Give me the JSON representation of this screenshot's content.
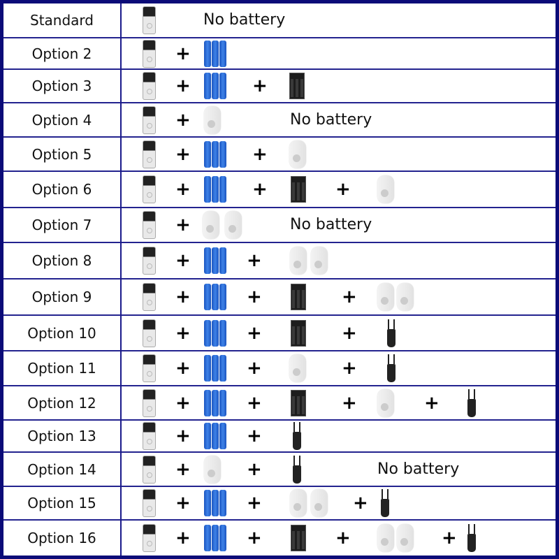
{
  "colors": {
    "border": "#0b0b78",
    "battery": "#2d6fd8"
  },
  "rows": [
    {
      "label": "Standard",
      "items": [
        {
          "type": "doorbell-icon"
        },
        {
          "type": "text",
          "text": "No battery"
        }
      ]
    },
    {
      "label": "Option 2",
      "items": [
        {
          "type": "doorbell-icon"
        },
        {
          "type": "plus",
          "text": "+"
        },
        {
          "type": "batteries-icon"
        }
      ]
    },
    {
      "label": "Option 3",
      "items": [
        {
          "type": "doorbell-icon"
        },
        {
          "type": "plus",
          "text": "+"
        },
        {
          "type": "batteries-icon"
        },
        {
          "type": "plus",
          "text": "+"
        },
        {
          "type": "charger-icon"
        }
      ]
    },
    {
      "label": "Option 4",
      "items": [
        {
          "type": "doorbell-icon"
        },
        {
          "type": "plus",
          "text": "+"
        },
        {
          "type": "chime-icon"
        },
        {
          "type": "text",
          "text": "No battery"
        }
      ]
    },
    {
      "label": "Option 5",
      "items": [
        {
          "type": "doorbell-icon"
        },
        {
          "type": "plus",
          "text": "+"
        },
        {
          "type": "batteries-icon"
        },
        {
          "type": "plus",
          "text": "+"
        },
        {
          "type": "chime-icon"
        }
      ]
    },
    {
      "label": "Option 6",
      "items": [
        {
          "type": "doorbell-icon"
        },
        {
          "type": "plus",
          "text": "+"
        },
        {
          "type": "batteries-icon"
        },
        {
          "type": "plus",
          "text": "+"
        },
        {
          "type": "charger-icon"
        },
        {
          "type": "plus",
          "text": "+"
        },
        {
          "type": "chime-icon"
        }
      ]
    },
    {
      "label": "Option 7",
      "items": [
        {
          "type": "doorbell-icon"
        },
        {
          "type": "plus",
          "text": "+"
        },
        {
          "type": "chime-icon"
        },
        {
          "type": "chime-icon"
        },
        {
          "type": "text",
          "text": "No battery"
        }
      ]
    },
    {
      "label": "Option 8",
      "items": [
        {
          "type": "doorbell-icon"
        },
        {
          "type": "plus",
          "text": "+"
        },
        {
          "type": "batteries-icon"
        },
        {
          "type": "plus",
          "text": "+"
        },
        {
          "type": "chime-icon"
        },
        {
          "type": "chime-icon"
        }
      ]
    },
    {
      "label": "Option 9",
      "items": [
        {
          "type": "doorbell-icon"
        },
        {
          "type": "plus",
          "text": "+"
        },
        {
          "type": "batteries-icon"
        },
        {
          "type": "plus",
          "text": "+"
        },
        {
          "type": "charger-icon"
        },
        {
          "type": "plus",
          "text": "+"
        },
        {
          "type": "chime-icon"
        },
        {
          "type": "chime-icon"
        }
      ]
    },
    {
      "label": "Option 10",
      "items": [
        {
          "type": "doorbell-icon"
        },
        {
          "type": "plus",
          "text": "+"
        },
        {
          "type": "batteries-icon"
        },
        {
          "type": "plus",
          "text": "+"
        },
        {
          "type": "charger-icon"
        },
        {
          "type": "plus",
          "text": "+"
        },
        {
          "type": "adapter-icon"
        }
      ]
    },
    {
      "label": "Option 11",
      "items": [
        {
          "type": "doorbell-icon"
        },
        {
          "type": "plus",
          "text": "+"
        },
        {
          "type": "batteries-icon"
        },
        {
          "type": "plus",
          "text": "+"
        },
        {
          "type": "chime-icon"
        },
        {
          "type": "plus",
          "text": "+"
        },
        {
          "type": "adapter-icon"
        }
      ]
    },
    {
      "label": "Option 12",
      "items": [
        {
          "type": "doorbell-icon"
        },
        {
          "type": "plus",
          "text": "+"
        },
        {
          "type": "batteries-icon"
        },
        {
          "type": "plus",
          "text": "+"
        },
        {
          "type": "charger-icon"
        },
        {
          "type": "plus",
          "text": "+"
        },
        {
          "type": "chime-icon"
        },
        {
          "type": "plus",
          "text": "+"
        },
        {
          "type": "adapter-icon"
        }
      ]
    },
    {
      "label": "Option 13",
      "items": [
        {
          "type": "doorbell-icon"
        },
        {
          "type": "plus",
          "text": "+"
        },
        {
          "type": "batteries-icon"
        },
        {
          "type": "plus",
          "text": "+"
        },
        {
          "type": "adapter-icon"
        }
      ]
    },
    {
      "label": "Option 14",
      "items": [
        {
          "type": "doorbell-icon"
        },
        {
          "type": "plus",
          "text": "+"
        },
        {
          "type": "chime-icon"
        },
        {
          "type": "plus",
          "text": "+"
        },
        {
          "type": "adapter-icon"
        },
        {
          "type": "text",
          "text": "No battery"
        }
      ]
    },
    {
      "label": "Option 15",
      "items": [
        {
          "type": "doorbell-icon"
        },
        {
          "type": "plus",
          "text": "+"
        },
        {
          "type": "batteries-icon"
        },
        {
          "type": "plus",
          "text": "+"
        },
        {
          "type": "chime-icon"
        },
        {
          "type": "chime-icon"
        },
        {
          "type": "plus",
          "text": "+"
        },
        {
          "type": "adapter-icon"
        }
      ]
    },
    {
      "label": "Option 16",
      "items": [
        {
          "type": "doorbell-icon"
        },
        {
          "type": "plus",
          "text": "+"
        },
        {
          "type": "batteries-icon"
        },
        {
          "type": "plus",
          "text": "+"
        },
        {
          "type": "charger-icon"
        },
        {
          "type": "plus",
          "text": "+"
        },
        {
          "type": "chime-icon"
        },
        {
          "type": "chime-icon"
        },
        {
          "type": "plus",
          "text": "+"
        },
        {
          "type": "adapter-icon"
        }
      ]
    }
  ]
}
